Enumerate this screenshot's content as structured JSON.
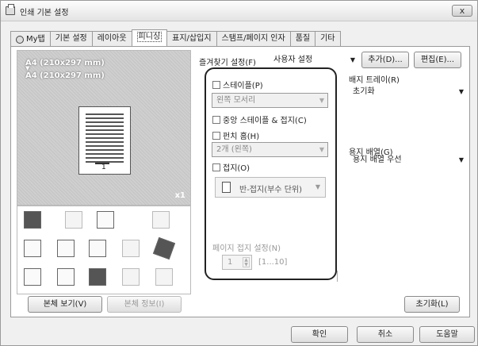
{
  "window": {
    "title": "인쇄 기본 설정",
    "close": "x"
  },
  "tabs": [
    "My탭",
    "기본 설정",
    "레이아웃",
    "피니싱",
    "표지/삽입지",
    "스탬프/페이지 인자",
    "품질",
    "기타"
  ],
  "preview": {
    "paper_top": "A4 (210x297 mm)",
    "arrow": "▼",
    "paper_bottom": "A4 (210x297 mm)",
    "copies": "x1",
    "page_number": "1",
    "view_button": "본체 보기(V)",
    "info_button": "본체 정보(I)"
  },
  "favorites": {
    "label": "즐겨찾기 설정(F)",
    "value": "사용자 설정",
    "add_button": "추가(D)...",
    "edit_button": "편집(E)..."
  },
  "finishing": {
    "staple_label": "스테이플(P)",
    "staple_value": "왼쪽 모서리",
    "center_staple_label": "중앙 스테이플 & 접지(C)",
    "punch_label": "펀치 홈(H)",
    "punch_value": "2개 (왼쪽)",
    "fold_label": "접지(O)",
    "fold_value": "반-접지(부수 단위)",
    "page_fold_label": "페이지 접지 설정(N)",
    "page_fold_value": "1",
    "page_fold_range": "[1...10]"
  },
  "output_tray": {
    "label": "배지 트레이(R)",
    "value": "초기화"
  },
  "paper_order": {
    "label": "용지 배열(G)",
    "value": "용지 배열 우선"
  },
  "reset_button": "초기화(L)",
  "footer": {
    "ok": "확인",
    "cancel": "취소",
    "help": "도움말"
  }
}
